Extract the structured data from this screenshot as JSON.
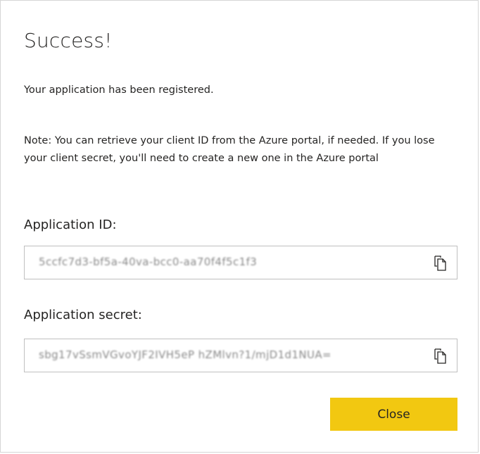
{
  "dialog": {
    "title": "Success!",
    "message": "Your application has been registered.",
    "note": "Note: You can retrieve your client ID from the Azure portal, if needed. If you lose your client secret, you'll need to create a new one in the Azure portal"
  },
  "fields": {
    "application_id": {
      "label": "Application ID:",
      "value": "5ccfc7d3-bf5a-40va-bcc0-aa70f4f5c1f3",
      "copy_icon": "copy-icon"
    },
    "application_secret": {
      "label": "Application secret:",
      "value": "sbg17vSsmVGvoYJF2IVH5eP hZMlvn?1/mjD1d1NUA=",
      "copy_icon": "copy-icon"
    }
  },
  "actions": {
    "close_label": "Close"
  },
  "colors": {
    "accent": "#f2c811",
    "text": "#252423",
    "border": "#bfbfbf"
  }
}
